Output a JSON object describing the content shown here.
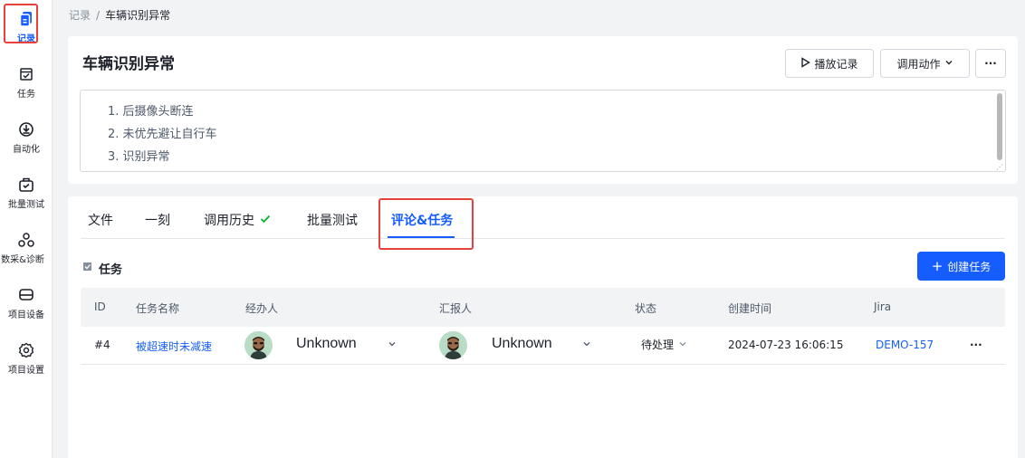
{
  "sidebar": {
    "items": [
      {
        "label": "记录",
        "icon": "document-icon",
        "active": true
      },
      {
        "label": "任务",
        "icon": "task-icon"
      },
      {
        "label": "自动化",
        "icon": "automation-icon"
      },
      {
        "label": "批量测试",
        "icon": "batch-test-icon"
      },
      {
        "label": "数采&诊断",
        "icon": "collect-diagnose-icon"
      },
      {
        "label": "项目设备",
        "icon": "device-icon"
      },
      {
        "label": "项目设置",
        "icon": "gear-icon"
      }
    ]
  },
  "breadcrumb": {
    "root": "记录",
    "separator": "/",
    "current": "车辆识别异常"
  },
  "record": {
    "title": "车辆识别异常",
    "play_label": "播放记录",
    "invoke_label": "调用动作",
    "more_label": "···",
    "description": [
      "1. 后摄像头断连",
      "2. 未优先避让自行车",
      "3. 识别异常"
    ]
  },
  "tabs": [
    {
      "label": "文件"
    },
    {
      "label": "一刻"
    },
    {
      "label": "调用历史"
    },
    {
      "label": "批量测试"
    },
    {
      "label": "评论&任务",
      "active": true
    }
  ],
  "tasks": {
    "section_title": "任务",
    "create_label": "创建任务",
    "columns": [
      "ID",
      "任务名称",
      "经办人",
      "汇报人",
      "状态",
      "创建时间",
      "Jira"
    ],
    "rows": [
      {
        "id": "#4",
        "name": "被超速时未减速",
        "assignee": "Unknown",
        "reporter": "Unknown",
        "status": "待处理",
        "created": "2024-07-23 16:06:15",
        "jira": "DEMO-157",
        "more": "···"
      }
    ]
  },
  "colors": {
    "accent": "#165dff",
    "highlight": "#e6413a",
    "success": "#00b42a"
  }
}
